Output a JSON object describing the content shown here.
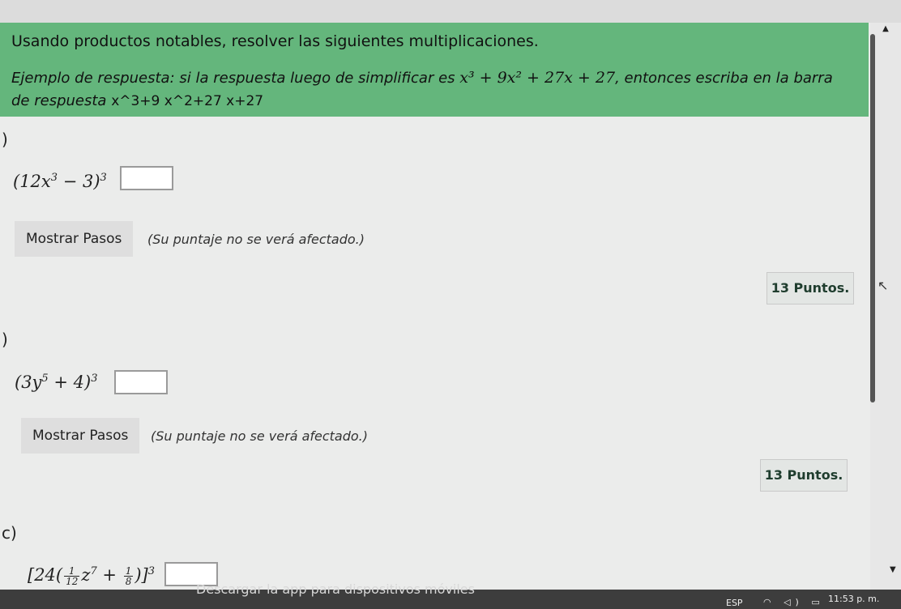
{
  "header": {
    "title": "Usando productos notables, resolver las siguientes multiplicaciones.",
    "example_text": "Ejemplo de respuesta: si la respuesta luego de simplificar es",
    "example_math": "x³ + 9x² + 27x + 27",
    "example_text2": ", entonces escriba en la barra de respuesta",
    "example_code": "x^3+9 x^2+27 x+27"
  },
  "problems": [
    {
      "label": ")",
      "expr_base": "(12x",
      "expr_exp1": "3",
      "expr_mid": " − 3)",
      "expr_exp2": "3",
      "steps_label": "Mostrar Pasos",
      "note": "(Su puntaje no se verá afectado.)",
      "points": "13 Puntos."
    },
    {
      "label": ")",
      "expr_base": "(3y",
      "expr_exp1": "5",
      "expr_mid": " + 4)",
      "expr_exp2": "3",
      "steps_label": "Mostrar Pasos",
      "note": "(Su puntaje no se verá afectado.)",
      "points": "13 Puntos."
    },
    {
      "label": "c)",
      "expr_pre": "[24(",
      "frac1_num": "1",
      "frac1_den": "12",
      "var": "z",
      "var_exp": "7",
      "plus": " + ",
      "frac2_num": "1",
      "frac2_den": "8",
      "expr_post": ")]",
      "expr_exp2": "3"
    }
  ],
  "footer": {
    "download": "Descargar la app para dispositivos móviles",
    "lang": "ESP",
    "tray": "◠ ◁) ▭",
    "time": "11:53 p. m."
  },
  "scrollbar": {
    "up": "▲",
    "down": "▼"
  },
  "cursor": {
    "glyph": "↖"
  }
}
